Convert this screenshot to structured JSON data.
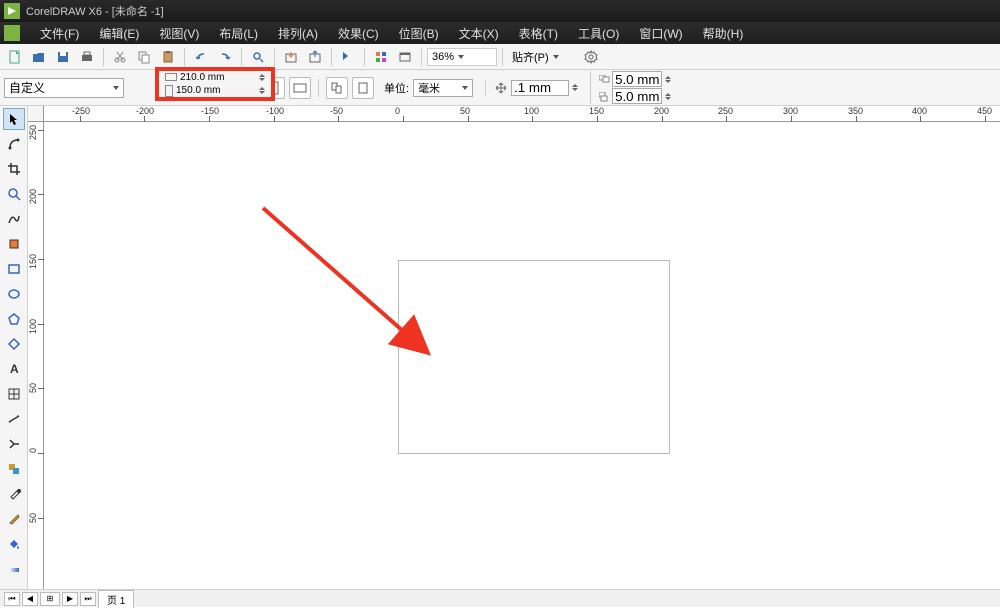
{
  "title": "CorelDRAW X6 - [未命名 -1]",
  "menu": {
    "file": "文件(F)",
    "edit": "编辑(E)",
    "view": "视图(V)",
    "layout": "布局(L)",
    "arrange": "排列(A)",
    "effects": "效果(C)",
    "bitmap": "位图(B)",
    "text": "文本(X)",
    "table": "表格(T)",
    "tools": "工具(O)",
    "window": "窗口(W)",
    "help": "帮助(H)"
  },
  "toolbar1": {
    "zoom": "36%",
    "snap": "贴齐(P)"
  },
  "toolbar2": {
    "preset": "自定义",
    "width": "210.0 mm",
    "height": "150.0 mm",
    "unit_label": "单位:",
    "unit_value": "毫米",
    "nudge": ".1 mm",
    "dup_x": "5.0 mm",
    "dup_y": "5.0 mm"
  },
  "ruler_h": {
    "ticks": [
      {
        "pos": 36,
        "label": "-250"
      },
      {
        "pos": 100,
        "label": "-200"
      },
      {
        "pos": 165,
        "label": "-150"
      },
      {
        "pos": 230,
        "label": "-100"
      },
      {
        "pos": 294,
        "label": "-50"
      },
      {
        "pos": 359,
        "label": "0"
      },
      {
        "pos": 424,
        "label": "50"
      },
      {
        "pos": 488,
        "label": "100"
      },
      {
        "pos": 553,
        "label": "150"
      },
      {
        "pos": 618,
        "label": "200"
      },
      {
        "pos": 682,
        "label": "250"
      },
      {
        "pos": 747,
        "label": "300"
      },
      {
        "pos": 812,
        "label": "350"
      },
      {
        "pos": 876,
        "label": "400"
      },
      {
        "pos": 941,
        "label": "450"
      }
    ]
  },
  "ruler_v": {
    "ticks": [
      {
        "pos": 8,
        "label": "250"
      },
      {
        "pos": 72,
        "label": "200"
      },
      {
        "pos": 137,
        "label": "150"
      },
      {
        "pos": 202,
        "label": "100"
      },
      {
        "pos": 266,
        "label": "50"
      },
      {
        "pos": 331,
        "label": "0"
      },
      {
        "pos": 396,
        "label": "50"
      }
    ]
  },
  "status": {
    "page_tab": "页 1"
  }
}
